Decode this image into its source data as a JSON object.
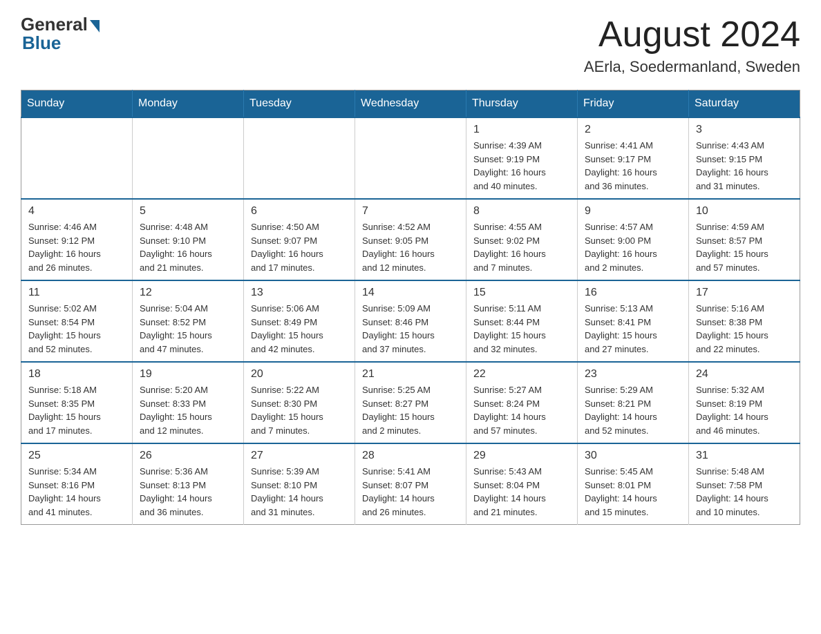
{
  "logo": {
    "general": "General",
    "blue": "Blue"
  },
  "header": {
    "month_year": "August 2024",
    "location": "AErla, Soedermanland, Sweden"
  },
  "weekdays": [
    "Sunday",
    "Monday",
    "Tuesday",
    "Wednesday",
    "Thursday",
    "Friday",
    "Saturday"
  ],
  "weeks": [
    [
      {
        "day": "",
        "info": ""
      },
      {
        "day": "",
        "info": ""
      },
      {
        "day": "",
        "info": ""
      },
      {
        "day": "",
        "info": ""
      },
      {
        "day": "1",
        "info": "Sunrise: 4:39 AM\nSunset: 9:19 PM\nDaylight: 16 hours\nand 40 minutes."
      },
      {
        "day": "2",
        "info": "Sunrise: 4:41 AM\nSunset: 9:17 PM\nDaylight: 16 hours\nand 36 minutes."
      },
      {
        "day": "3",
        "info": "Sunrise: 4:43 AM\nSunset: 9:15 PM\nDaylight: 16 hours\nand 31 minutes."
      }
    ],
    [
      {
        "day": "4",
        "info": "Sunrise: 4:46 AM\nSunset: 9:12 PM\nDaylight: 16 hours\nand 26 minutes."
      },
      {
        "day": "5",
        "info": "Sunrise: 4:48 AM\nSunset: 9:10 PM\nDaylight: 16 hours\nand 21 minutes."
      },
      {
        "day": "6",
        "info": "Sunrise: 4:50 AM\nSunset: 9:07 PM\nDaylight: 16 hours\nand 17 minutes."
      },
      {
        "day": "7",
        "info": "Sunrise: 4:52 AM\nSunset: 9:05 PM\nDaylight: 16 hours\nand 12 minutes."
      },
      {
        "day": "8",
        "info": "Sunrise: 4:55 AM\nSunset: 9:02 PM\nDaylight: 16 hours\nand 7 minutes."
      },
      {
        "day": "9",
        "info": "Sunrise: 4:57 AM\nSunset: 9:00 PM\nDaylight: 16 hours\nand 2 minutes."
      },
      {
        "day": "10",
        "info": "Sunrise: 4:59 AM\nSunset: 8:57 PM\nDaylight: 15 hours\nand 57 minutes."
      }
    ],
    [
      {
        "day": "11",
        "info": "Sunrise: 5:02 AM\nSunset: 8:54 PM\nDaylight: 15 hours\nand 52 minutes."
      },
      {
        "day": "12",
        "info": "Sunrise: 5:04 AM\nSunset: 8:52 PM\nDaylight: 15 hours\nand 47 minutes."
      },
      {
        "day": "13",
        "info": "Sunrise: 5:06 AM\nSunset: 8:49 PM\nDaylight: 15 hours\nand 42 minutes."
      },
      {
        "day": "14",
        "info": "Sunrise: 5:09 AM\nSunset: 8:46 PM\nDaylight: 15 hours\nand 37 minutes."
      },
      {
        "day": "15",
        "info": "Sunrise: 5:11 AM\nSunset: 8:44 PM\nDaylight: 15 hours\nand 32 minutes."
      },
      {
        "day": "16",
        "info": "Sunrise: 5:13 AM\nSunset: 8:41 PM\nDaylight: 15 hours\nand 27 minutes."
      },
      {
        "day": "17",
        "info": "Sunrise: 5:16 AM\nSunset: 8:38 PM\nDaylight: 15 hours\nand 22 minutes."
      }
    ],
    [
      {
        "day": "18",
        "info": "Sunrise: 5:18 AM\nSunset: 8:35 PM\nDaylight: 15 hours\nand 17 minutes."
      },
      {
        "day": "19",
        "info": "Sunrise: 5:20 AM\nSunset: 8:33 PM\nDaylight: 15 hours\nand 12 minutes."
      },
      {
        "day": "20",
        "info": "Sunrise: 5:22 AM\nSunset: 8:30 PM\nDaylight: 15 hours\nand 7 minutes."
      },
      {
        "day": "21",
        "info": "Sunrise: 5:25 AM\nSunset: 8:27 PM\nDaylight: 15 hours\nand 2 minutes."
      },
      {
        "day": "22",
        "info": "Sunrise: 5:27 AM\nSunset: 8:24 PM\nDaylight: 14 hours\nand 57 minutes."
      },
      {
        "day": "23",
        "info": "Sunrise: 5:29 AM\nSunset: 8:21 PM\nDaylight: 14 hours\nand 52 minutes."
      },
      {
        "day": "24",
        "info": "Sunrise: 5:32 AM\nSunset: 8:19 PM\nDaylight: 14 hours\nand 46 minutes."
      }
    ],
    [
      {
        "day": "25",
        "info": "Sunrise: 5:34 AM\nSunset: 8:16 PM\nDaylight: 14 hours\nand 41 minutes."
      },
      {
        "day": "26",
        "info": "Sunrise: 5:36 AM\nSunset: 8:13 PM\nDaylight: 14 hours\nand 36 minutes."
      },
      {
        "day": "27",
        "info": "Sunrise: 5:39 AM\nSunset: 8:10 PM\nDaylight: 14 hours\nand 31 minutes."
      },
      {
        "day": "28",
        "info": "Sunrise: 5:41 AM\nSunset: 8:07 PM\nDaylight: 14 hours\nand 26 minutes."
      },
      {
        "day": "29",
        "info": "Sunrise: 5:43 AM\nSunset: 8:04 PM\nDaylight: 14 hours\nand 21 minutes."
      },
      {
        "day": "30",
        "info": "Sunrise: 5:45 AM\nSunset: 8:01 PM\nDaylight: 14 hours\nand 15 minutes."
      },
      {
        "day": "31",
        "info": "Sunrise: 5:48 AM\nSunset: 7:58 PM\nDaylight: 14 hours\nand 10 minutes."
      }
    ]
  ]
}
